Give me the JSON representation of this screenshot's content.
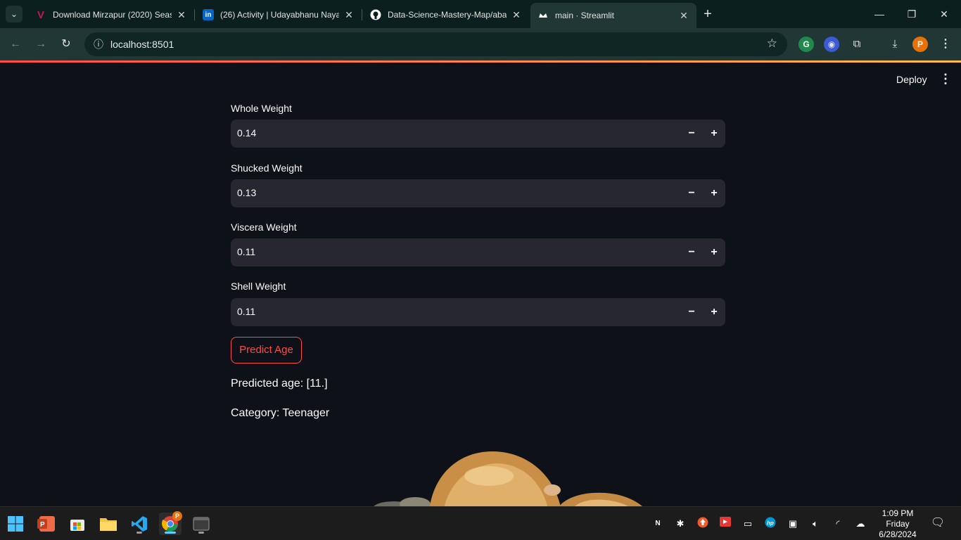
{
  "browser": {
    "tabs": [
      {
        "title": "Download Mirzapur (2020) Seas",
        "favicon": "V",
        "favicon_color": "#9b1c5a"
      },
      {
        "title": "(26) Activity | Udayabhanu Naya",
        "favicon": "in",
        "favicon_color": "#0a66c2"
      },
      {
        "title": "Data-Science-Mastery-Map/aba",
        "favicon": "gh",
        "favicon_color": "#ffffff"
      },
      {
        "title": "main · Streamlit",
        "favicon": "st",
        "favicon_color": "#ffffff"
      }
    ],
    "url": "localhost:8501",
    "profile_initial": "P"
  },
  "app": {
    "deploy_label": "Deploy",
    "fields": [
      {
        "label": "Whole Weight",
        "value": "0.14"
      },
      {
        "label": "Shucked Weight",
        "value": "0.13"
      },
      {
        "label": "Viscera Weight",
        "value": "0.11"
      },
      {
        "label": "Shell Weight",
        "value": "0.11"
      }
    ],
    "predict_button": "Predict Age",
    "predicted_age": "Predicted age: [11.]",
    "category": "Category: Teenager",
    "accent_color": "#ff4b4b"
  },
  "taskbar": {
    "time": "1:09 PM",
    "day": "Friday",
    "date": "6/28/2024"
  }
}
